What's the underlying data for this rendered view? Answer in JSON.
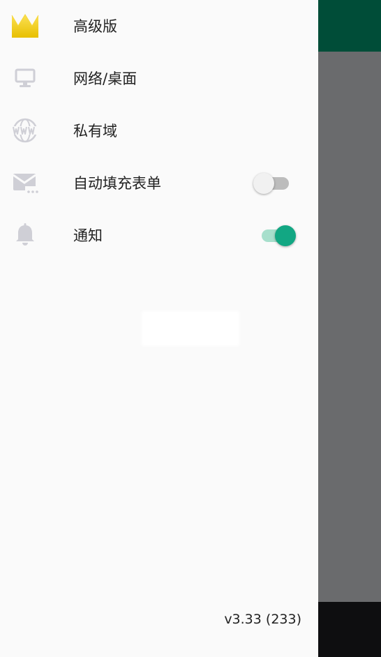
{
  "colors": {
    "app_bar": "#004d38",
    "accent": "#12a783",
    "accent_track": "#a7dfcc",
    "drawer_bg": "#fafafa",
    "icon_grey": "#cfcfd6",
    "crown_yellow": "#f2cc1c"
  },
  "drawer": {
    "items": [
      {
        "label": "高级版",
        "icon": "crown-icon"
      },
      {
        "label": "网络/桌面",
        "icon": "monitor-icon"
      },
      {
        "label": "私有域",
        "icon": "www-globe-icon"
      },
      {
        "label": "自动填充表单",
        "icon": "mail-dots-icon",
        "toggle": "off"
      },
      {
        "label": "通知",
        "icon": "bell-icon",
        "toggle": "on"
      }
    ],
    "version": "v3.33 (233)"
  }
}
